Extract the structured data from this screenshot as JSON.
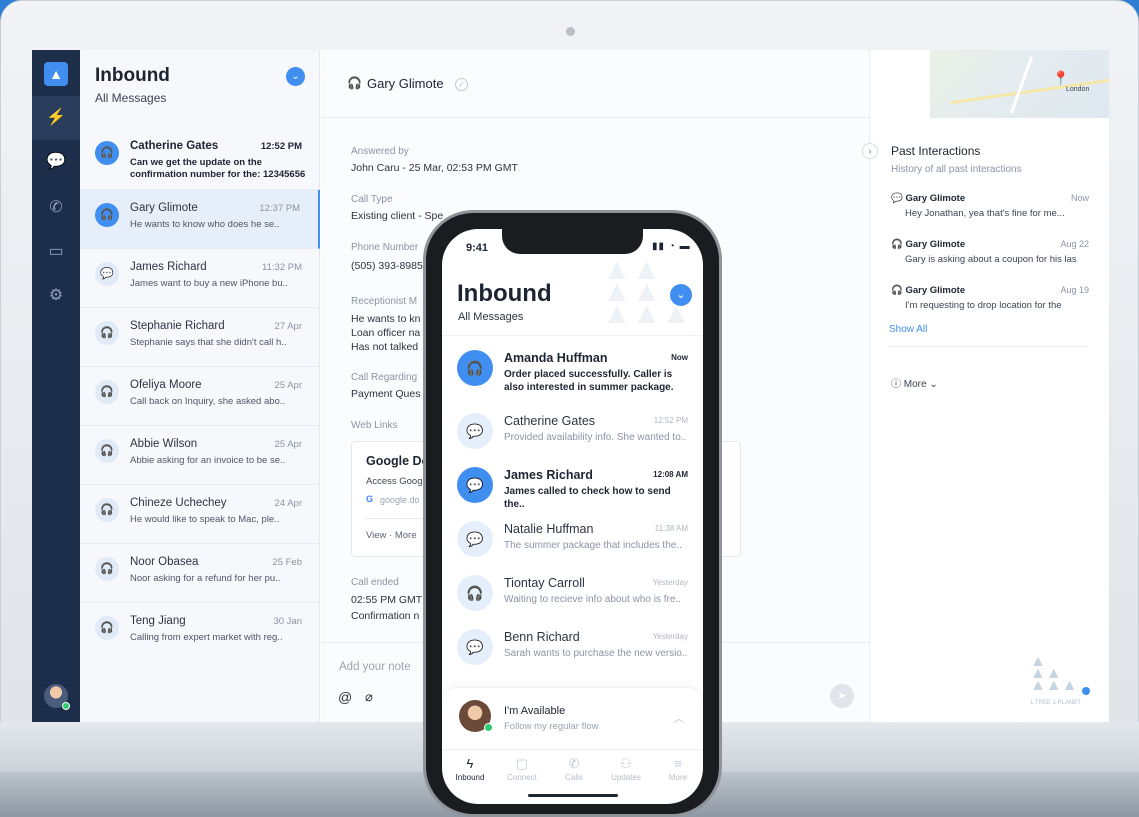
{
  "desktop": {
    "list": {
      "title": "Inbound",
      "subtitle": "All Messages",
      "items": [
        {
          "name": "Catherine Gates",
          "time": "12:52 PM",
          "preview": "Can we get the update on the confirmation number for the: 12345656",
          "unread": true,
          "icon": "headset-icon"
        },
        {
          "name": "Gary Glimote",
          "time": "12:37 PM",
          "preview": "He wants to know who does he se..",
          "unread": false,
          "icon": "headset-icon"
        },
        {
          "name": "James Richard",
          "time": "11:32 PM",
          "preview": "James want to buy a new iPhone bu..",
          "unread": false,
          "icon": "chat-icon"
        },
        {
          "name": "Stephanie Richard",
          "time": "27 Apr",
          "preview": "Stephanie says that she didn't call h..",
          "unread": false,
          "icon": "headset-icon"
        },
        {
          "name": "Ofeliya Moore",
          "time": "25 Apr",
          "preview": "Call back on Inquiry, she asked abo..",
          "unread": false,
          "icon": "headset-icon"
        },
        {
          "name": "Abbie Wilson",
          "time": "25 Apr",
          "preview": "Abbie asking for an invoice to be se..",
          "unread": false,
          "icon": "headset-icon"
        },
        {
          "name": "Chineze Uchechey",
          "time": "24 Apr",
          "preview": "He would like to speak to Mac, ple..",
          "unread": false,
          "icon": "headset-icon"
        },
        {
          "name": "Noor Obasea",
          "time": "25 Feb",
          "preview": "Noor asking for a refund for her pu..",
          "unread": false,
          "icon": "headset-icon"
        },
        {
          "name": "Teng Jiang",
          "time": "30 Jan",
          "preview": "Calling from expert market with reg..",
          "unread": false,
          "icon": "headset-icon"
        }
      ]
    },
    "detail": {
      "contact": "Gary Glimote",
      "answered_label": "Answered by",
      "answered_value": "John Caru - 25 Mar, 02:53 PM GMT",
      "call_type_label": "Call Type",
      "call_type_value": "Existing client - Spe",
      "phone_label": "Phone Number",
      "phone_value": "(505) 393-8985",
      "receptionist_label": "Receptionist M",
      "receptionist_lines": [
        "He wants to kn",
        "Loan officer na",
        "Has not talked"
      ],
      "regarding_label": "Call Regarding",
      "regarding_value": "Payment Ques",
      "weblinks_label": "Web Links",
      "weblink_title": "Google Do",
      "weblink_desc": "Access Googl",
      "weblink_url": "google.do",
      "weblink_actions": "View · More",
      "ended_label": "Call ended",
      "ended_value": "02:55 PM GMT",
      "confirmation_value": "Confirmation n",
      "note_placeholder": "Add your note"
    },
    "panel": {
      "map_city": "London",
      "title": "Past Interactions",
      "subtitle": "History of all past interactions",
      "items": [
        {
          "name": "Gary Glimote",
          "date": "Now",
          "preview": "Hey Jonathan, yea that's fine for me...",
          "icon": "chat-icon"
        },
        {
          "name": "Gary Glimote",
          "date": "Aug 22",
          "preview": "Gary is asking about a coupon for his las",
          "icon": "headset-icon"
        },
        {
          "name": "Gary Glimote",
          "date": "Aug 19",
          "preview": "I'm requesting to drop location for the",
          "icon": "headset-icon"
        }
      ],
      "show_all": "Show All",
      "more": "More",
      "tree_tagline": "1 TREE 1 PLANET"
    }
  },
  "phone": {
    "status_time": "9:41",
    "title": "Inbound",
    "subtitle": "All Messages",
    "items": [
      {
        "name": "Amanda Huffman",
        "time": "Now",
        "preview": "Order placed successfully. Caller is also interested in summer package.",
        "unread": true,
        "icon": "headset-icon"
      },
      {
        "name": "Catherine Gates",
        "time": "12:52 PM",
        "preview": "Provided availability info. She wanted to..",
        "unread": false,
        "icon": "chat-icon"
      },
      {
        "name": "James Richard",
        "time": "12:08 AM",
        "preview": "James called to check how to send the..",
        "unread": true,
        "icon": "chat-icon"
      },
      {
        "name": "Natalie Huffman",
        "time": "11:38 AM",
        "preview": "The summer package that includes the..",
        "unread": false,
        "icon": "chat-icon"
      },
      {
        "name": "Tiontay Carroll",
        "time": "Yesterday",
        "preview": "Waiting to recieve info about who is fre..",
        "unread": false,
        "icon": "headset-icon"
      },
      {
        "name": "Benn Richard",
        "time": "Yesterday",
        "preview": "Sarah wants to purchase the new versio..",
        "unread": false,
        "icon": "chat-icon"
      }
    ],
    "status": {
      "title": "I'm Available",
      "subtitle": "Follow my regular flow"
    },
    "tabs": [
      {
        "label": "Inbound",
        "icon": "bolt-icon"
      },
      {
        "label": "Connect",
        "icon": "chat-icon"
      },
      {
        "label": "Calls",
        "icon": "phone-icon"
      },
      {
        "label": "Updates",
        "icon": "people-icon"
      },
      {
        "label": "More",
        "icon": "menu-icon"
      }
    ]
  }
}
